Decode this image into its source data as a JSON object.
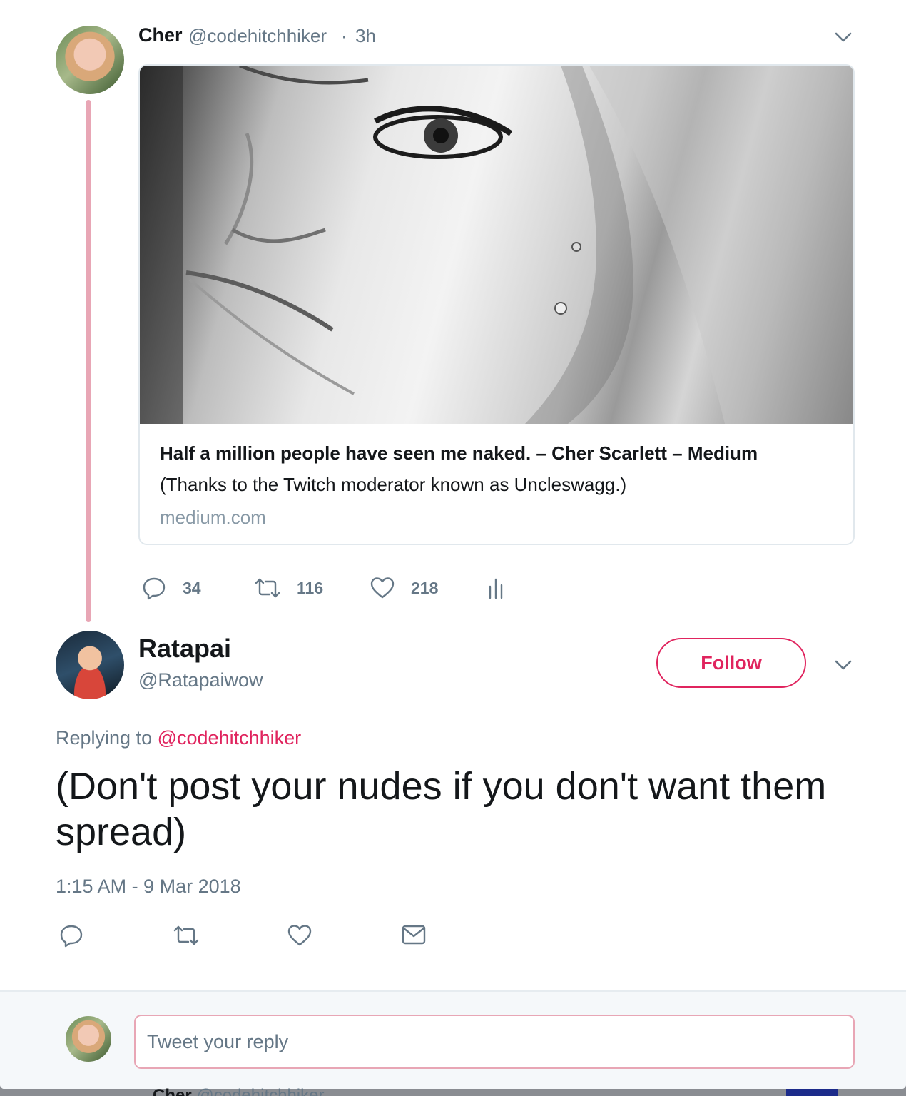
{
  "tweet1": {
    "name": "Cher",
    "handle": "@codehitchhiker",
    "separator": "·",
    "time": "3h",
    "card": {
      "title": "Half a million people have seen me naked. – Cher Scarlett – Medium",
      "description": "(Thanks to the Twitch moderator known as Uncleswagg.)",
      "domain": "medium.com"
    },
    "actions": {
      "replies": "34",
      "retweets": "116",
      "likes": "218"
    }
  },
  "tweet2": {
    "name": "Ratapai",
    "handle": "@Ratapaiwow",
    "follow_label": "Follow",
    "replying_prefix": "Replying to",
    "replying_handle": "@codehitchhiker",
    "text": "(Don't post your nudes if you don't want them spread)",
    "timestamp": "1:15 AM - 9 Mar 2018"
  },
  "reply_box": {
    "placeholder": "Tweet your reply"
  },
  "below_tweet": {
    "name": "Cher",
    "handle": "@codehitchhiker"
  },
  "colors": {
    "accent": "#e0245e",
    "thread_line": "#e8a6b5",
    "secondary_text": "#657786"
  }
}
